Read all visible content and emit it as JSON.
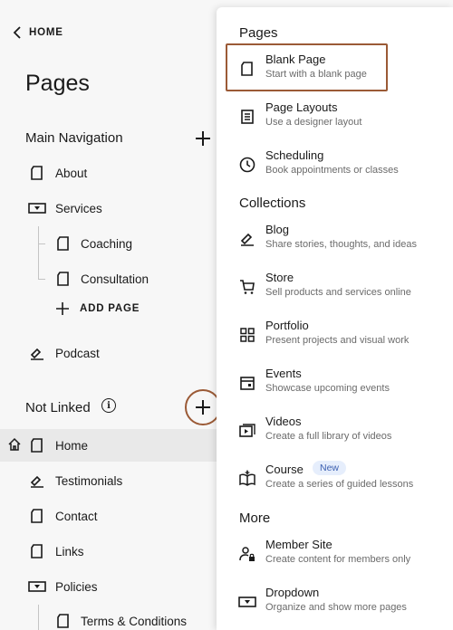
{
  "header": {
    "back_label": "HOME",
    "title": "Pages"
  },
  "main_nav": {
    "title": "Main Navigation",
    "items": [
      {
        "label": "About"
      },
      {
        "label": "Services"
      },
      {
        "label": "Coaching"
      },
      {
        "label": "Consultation"
      },
      {
        "label": "Podcast"
      }
    ],
    "add_page_label": "ADD PAGE"
  },
  "not_linked": {
    "title": "Not Linked",
    "items": [
      {
        "label": "Home"
      },
      {
        "label": "Testimonials"
      },
      {
        "label": "Contact"
      },
      {
        "label": "Links"
      },
      {
        "label": "Policies"
      },
      {
        "label": "Terms & Conditions"
      }
    ]
  },
  "menu": {
    "groups": [
      {
        "title": "Pages"
      },
      {
        "title": "Collections"
      },
      {
        "title": "More"
      }
    ],
    "options": [
      {
        "title": "Blank Page",
        "desc": "Start with a blank page",
        "icon": "blank-page-icon"
      },
      {
        "title": "Page Layouts",
        "desc": "Use a designer layout",
        "icon": "layout-icon"
      },
      {
        "title": "Scheduling",
        "desc": "Book appointments or classes",
        "icon": "clock-icon"
      },
      {
        "title": "Blog",
        "desc": "Share stories, thoughts, and ideas",
        "icon": "blog-icon"
      },
      {
        "title": "Store",
        "desc": "Sell products and services online",
        "icon": "cart-icon"
      },
      {
        "title": "Portfolio",
        "desc": "Present projects and visual work",
        "icon": "grid-icon"
      },
      {
        "title": "Events",
        "desc": "Showcase upcoming events",
        "icon": "calendar-icon"
      },
      {
        "title": "Videos",
        "desc": "Create a full library of videos",
        "icon": "video-icon"
      },
      {
        "title": "Course",
        "desc": "Create a series of guided lessons",
        "badge": "New",
        "icon": "book-icon"
      },
      {
        "title": "Member Site",
        "desc": "Create content for members only",
        "icon": "member-icon"
      },
      {
        "title": "Dropdown",
        "desc": "Organize and show more pages",
        "icon": "dropdown-icon"
      }
    ]
  },
  "colors": {
    "highlight": "#9b5a36",
    "badge_bg": "#e6eefc",
    "badge_text": "#3b5fb0"
  }
}
